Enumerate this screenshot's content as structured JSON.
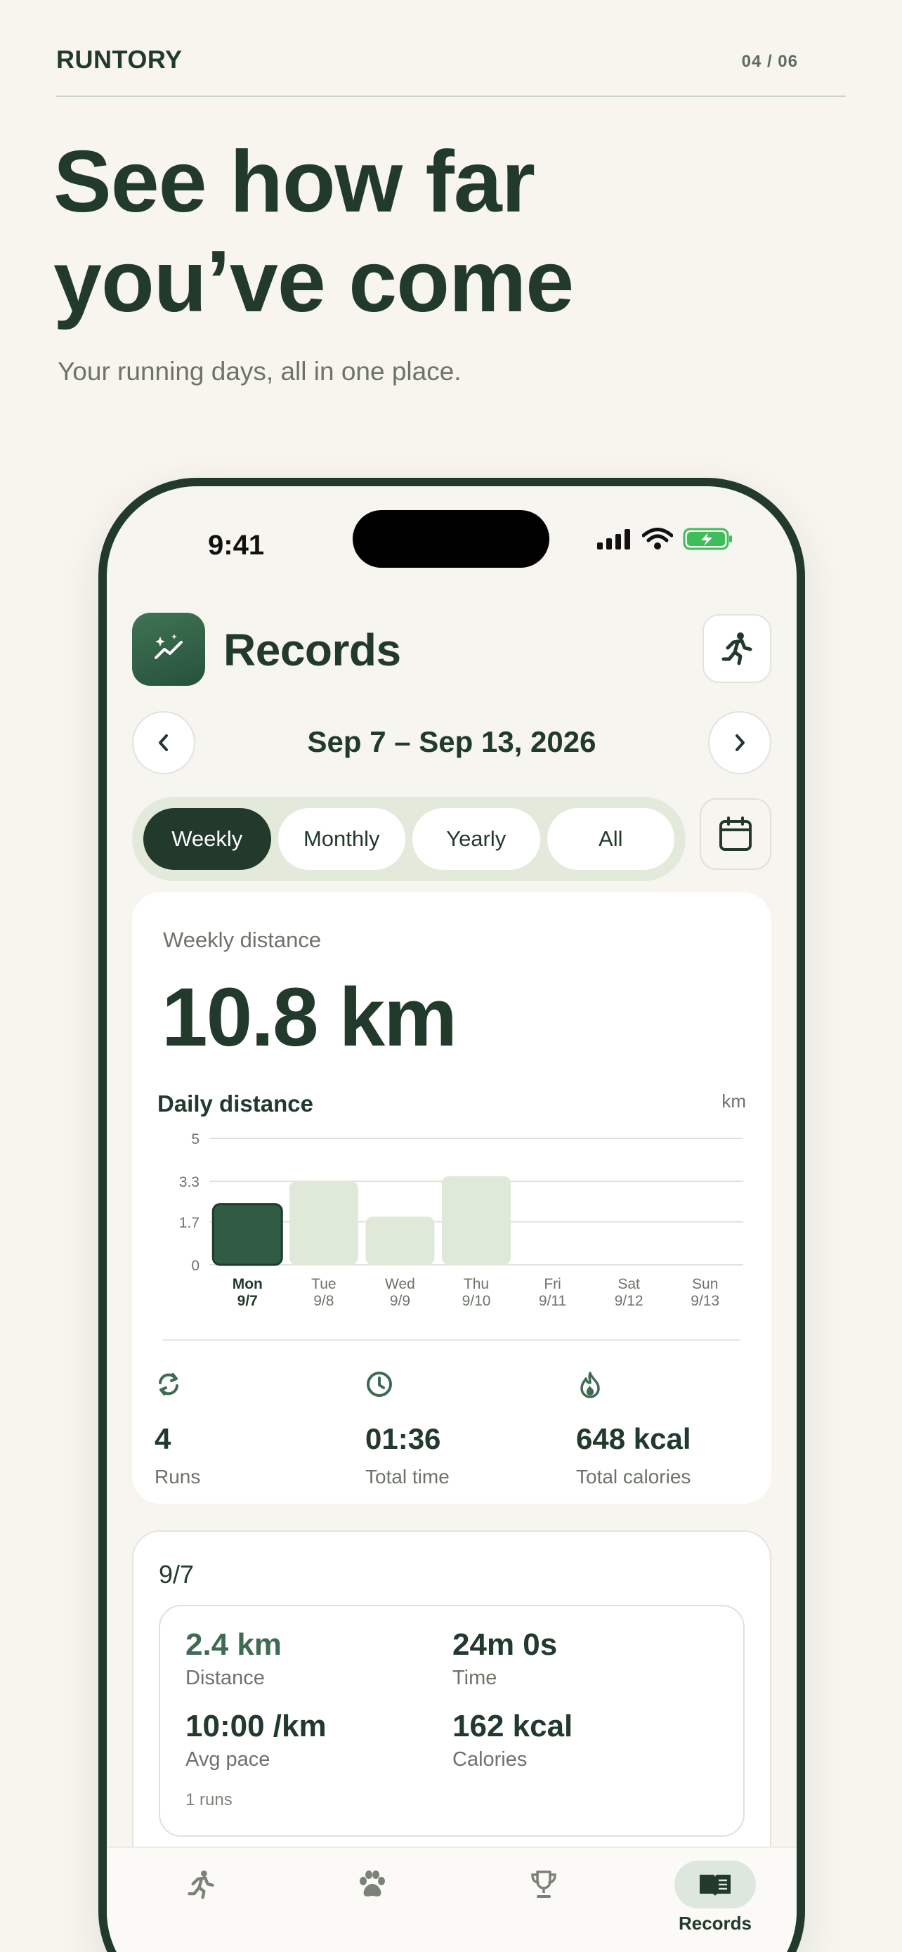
{
  "header": {
    "brand": "RUNTORY",
    "pager": "04 / 06",
    "headline_line1": "See how far",
    "headline_line2": "you’ve come",
    "subhead": "Your running days, all in one place."
  },
  "status_bar": {
    "time": "9:41",
    "icons": [
      "signal-icon",
      "wifi-icon",
      "battery-icon"
    ]
  },
  "app": {
    "title": "Records",
    "date_range": "Sep 7 – Sep 13, 2026",
    "tabs": [
      {
        "label": "Weekly",
        "active": true
      },
      {
        "label": "Monthly",
        "active": false
      },
      {
        "label": "Yearly",
        "active": false
      },
      {
        "label": "All",
        "active": false
      }
    ],
    "summary": {
      "label": "Weekly distance",
      "value": "10.8 km",
      "chart_title": "Daily distance",
      "unit": "km"
    },
    "stats": [
      {
        "icon": "repeat-icon",
        "value": "4",
        "label": "Runs"
      },
      {
        "icon": "clock-icon",
        "value": "01:36",
        "label": "Total time"
      },
      {
        "icon": "flame-icon",
        "value": "648 kcal",
        "label": "Total calories"
      }
    ],
    "day_card": {
      "date": "9/7",
      "distance_value": "2.4 km",
      "distance_label": "Distance",
      "time_value": "24m 0s",
      "time_label": "Time",
      "pace_value": "10:00 /km",
      "pace_label": "Avg pace",
      "calories_value": "162 kcal",
      "calories_label": "Calories",
      "runs_note": "1 runs"
    },
    "tabbar": [
      {
        "icon": "runner-icon",
        "label": "",
        "active": false
      },
      {
        "icon": "paw-icon",
        "label": "",
        "active": false
      },
      {
        "icon": "trophy-icon",
        "label": "",
        "active": false
      },
      {
        "icon": "book-icon",
        "label": "Records",
        "active": true
      }
    ]
  },
  "colors": {
    "background": "#f7f5ee",
    "primary": "#213a2c",
    "accent_green": "#3e6b51",
    "bar_selected": "#2f5c43",
    "bar_default": "#dfe9da",
    "muted_text": "#6c7469"
  },
  "chart_data": {
    "type": "bar",
    "title": "Daily distance",
    "ylabel": "km",
    "ylim": [
      0,
      5
    ],
    "y_ticks": [
      "5",
      "3.3",
      "1.7",
      "0"
    ],
    "y_tick_values": [
      5,
      3.3,
      1.7,
      0
    ],
    "categories": [
      "Mon",
      "Tue",
      "Wed",
      "Thu",
      "Fri",
      "Sat",
      "Sun"
    ],
    "dates": [
      "9/7",
      "9/8",
      "9/9",
      "9/10",
      "9/11",
      "9/12",
      "9/13"
    ],
    "values": [
      2.4,
      3.3,
      1.9,
      3.5,
      0,
      0,
      0
    ],
    "selected_index": 0,
    "grid": true
  }
}
